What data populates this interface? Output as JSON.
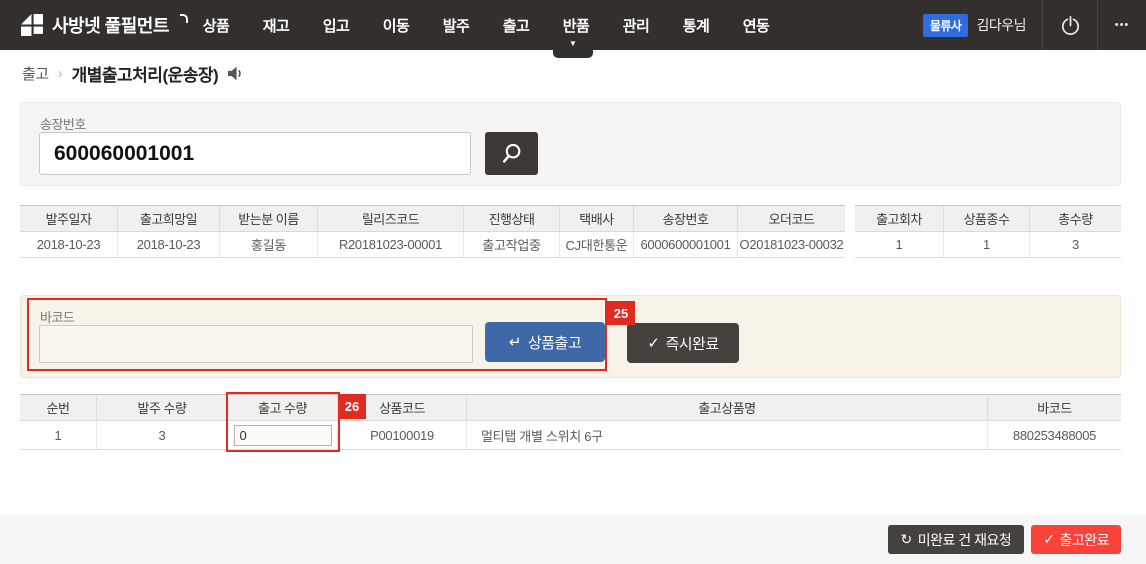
{
  "nav": {
    "brand": "사방넷 풀필먼트",
    "items": [
      "상품",
      "재고",
      "입고",
      "이동",
      "발주",
      "출고",
      "반품",
      "관리",
      "통계",
      "연동"
    ],
    "active_indicator_under": "반품",
    "user_badge": "물류사",
    "user_name": "김다우님"
  },
  "breadcrumb": {
    "section": "출고",
    "page": "개별출고처리(운송장)"
  },
  "search": {
    "label": "송장번호",
    "value": "600060001001"
  },
  "order_table": {
    "headers": [
      "발주일자",
      "출고희망일",
      "받는분 이름",
      "릴리즈코드",
      "진행상태",
      "택배사",
      "송장번호",
      "오더코드"
    ],
    "row": [
      "2018-10-23",
      "2018-10-23",
      "홍길동",
      "R20181023-00001",
      "출고작업중",
      "CJ대한통운",
      "6000600001001",
      "O20181023-00032"
    ]
  },
  "summary_table": {
    "headers": [
      "출고회차",
      "상품종수",
      "총수량"
    ],
    "row": [
      "1",
      "1",
      "3"
    ]
  },
  "barcode_panel": {
    "label": "바코드",
    "input_value": "",
    "ship_button": "상품출고",
    "instant_button": "즉시완료",
    "annotation": "25"
  },
  "items_table": {
    "headers": [
      "순번",
      "발주 수량",
      "출고 수량",
      "상품코드",
      "출고상품명",
      "바코드"
    ],
    "annotation": "26",
    "row": {
      "no": "1",
      "ordered_qty": "3",
      "ship_qty": "0",
      "product_code": "P00100019",
      "product_name": "멀티탭 개별 스위치 6구",
      "barcode": "880253488005"
    }
  },
  "footer": {
    "retry_button": "미완료 건 재요청",
    "complete_button": "출고완료"
  },
  "glyphs": {
    "caret": "▼",
    "dots": "•••",
    "separator": "›",
    "enter": "↵",
    "check": "✓",
    "refresh": "↻"
  },
  "colors": {
    "nav_bg": "#322f2d",
    "accent_blue": "#2e6ce0",
    "ship_button_blue": "#3e68a8",
    "annotation_red": "#e02b20",
    "complete_red": "#f8423a",
    "dark_button": "#45423e",
    "panel_gray": "#f6f5f3",
    "panel_beige": "#f8f3e9",
    "table_header_bg": "#f1f0ee"
  }
}
